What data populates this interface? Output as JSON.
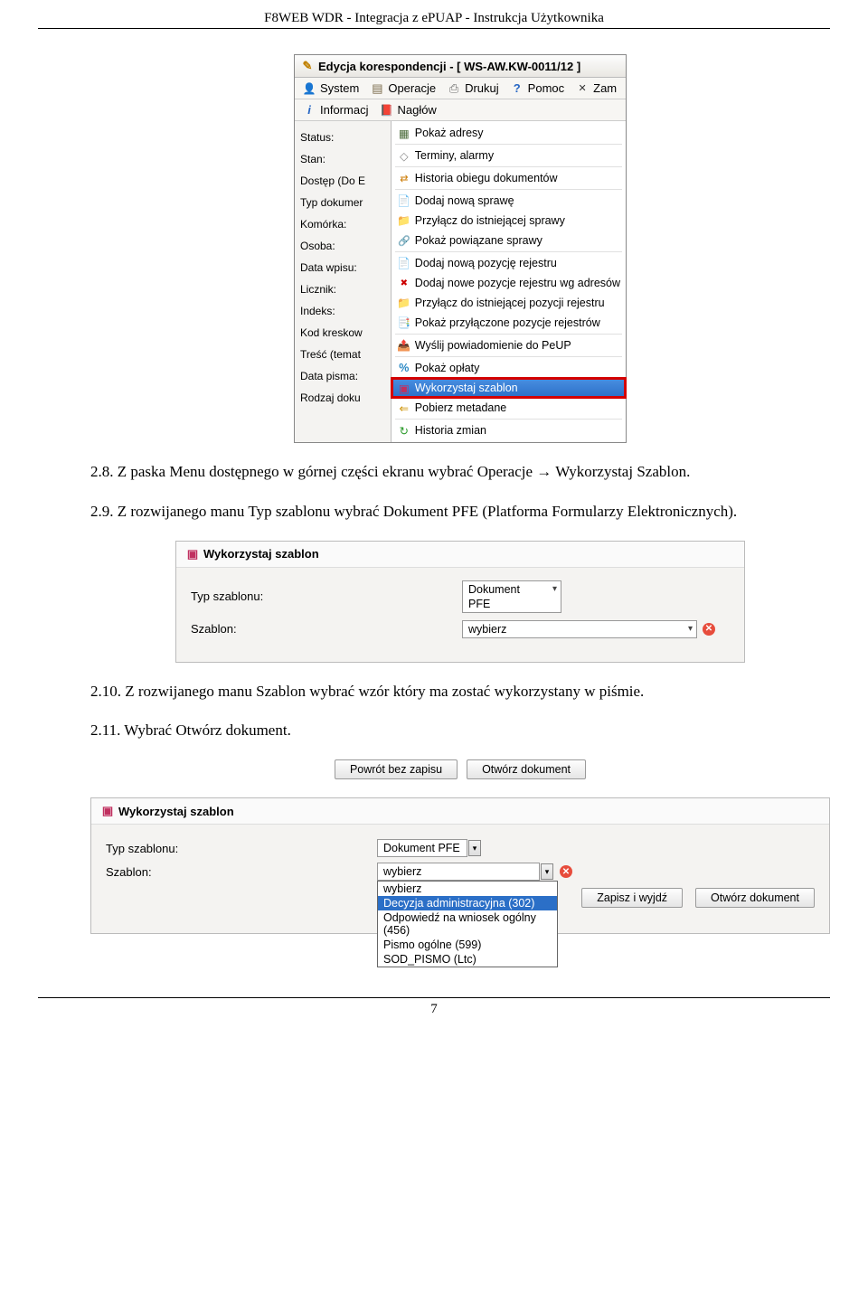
{
  "doc_header": "F8WEB WDR - Integracja z ePUAP - Instrukcja Użytkownika",
  "page_number": "7",
  "para_28": "2.8. Z paska Menu dostępnego w górnej części ekranu wybrać Operacje → Wykorzystaj Szablon.",
  "para_29": "2.9. Z rozwijanego manu Typ szablonu wybrać Dokument PFE (Platforma Formularzy Elektronicznych).",
  "para_210": "2.10. Z rozwijanego manu Szablon wybrać wzór który ma zostać wykorzystany w piśmie.",
  "para_211": "2.11. Wybrać Otwórz dokument.",
  "fig1": {
    "title": "Edycja korespondencji - [ WS-AW.KW-0011/12 ]",
    "menubar": [
      "System",
      "Operacje",
      "Drukuj",
      "Pomoc",
      "Zam"
    ],
    "tabs": [
      "Informacj",
      "Nagłów"
    ],
    "labels": [
      "Status:",
      "Stan:",
      "Dostęp (Do E",
      "Typ dokumer",
      "Komórka:",
      "Osoba:",
      "Data wpisu:",
      "Licznik:",
      "Indeks:",
      "Kod kreskow",
      "Treść (temat",
      "Data pisma:",
      "Rodzaj doku"
    ],
    "items": [
      "Pokaż adresy",
      "Terminy, alarmy",
      "Historia obiegu dokumentów",
      "Dodaj nową sprawę",
      "Przyłącz do istniejącej sprawy",
      "Pokaż powiązane sprawy",
      "Dodaj nową pozycję rejestru",
      "Dodaj nowe pozycje rejestru wg adresów",
      "Przyłącz do istniejącej pozycji rejestru",
      "Pokaż przyłączone pozycje rejestrów",
      "Wyślij powiadomienie do PeUP",
      "Pokaż opłaty",
      "Wykorzystaj szablon",
      "Pobierz metadane",
      "Historia zmian"
    ]
  },
  "fig2": {
    "hdr": "Wykorzystaj szablon",
    "l1": "Typ szablonu:",
    "v1": "Dokument PFE",
    "l2": "Szablon:",
    "v2": "wybierz"
  },
  "fig3": {
    "b1": "Powrót bez zapisu",
    "b2": "Otwórz dokument"
  },
  "fig4": {
    "hdr": "Wykorzystaj szablon",
    "l1": "Typ szablonu:",
    "v1": "Dokument PFE",
    "l2": "Szablon:",
    "v2": "wybierz",
    "opts": [
      "wybierz",
      "Decyzja administracyjna (302)",
      "Odpowiedź na wniosek ogólny (456)",
      "Pismo ogólne (599)",
      "SOD_PISMO (Ltc)"
    ],
    "b1": "Zapisz i wyjdź",
    "b2": "Otwórz dokument"
  }
}
